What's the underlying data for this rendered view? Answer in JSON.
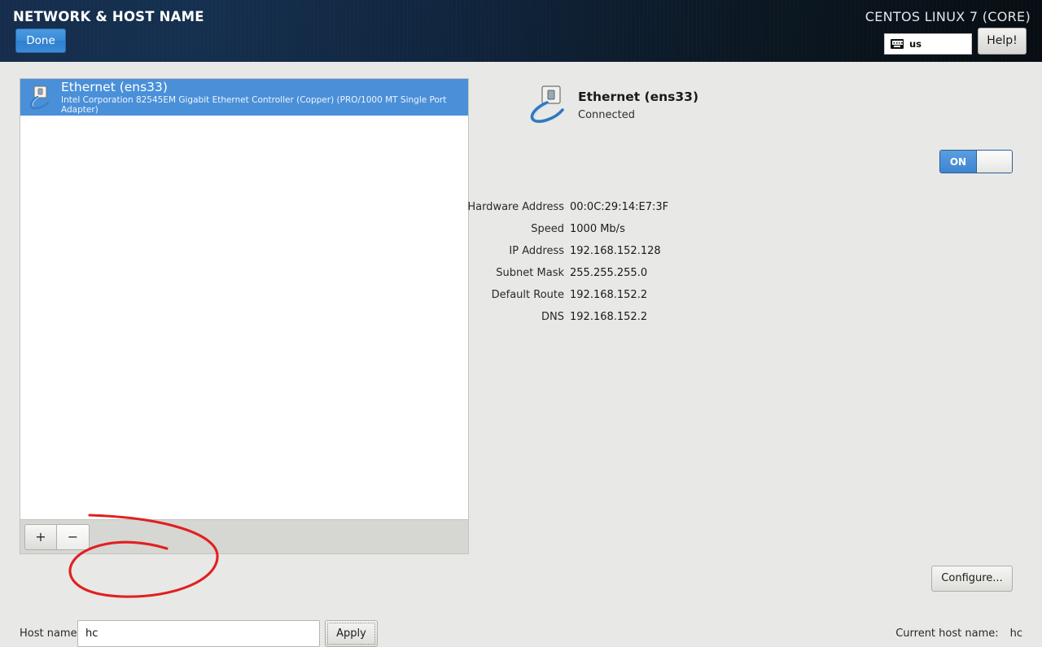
{
  "header": {
    "spine_title": "NETWORK & HOST NAME",
    "done_label": "Done",
    "distro_title": "CENTOS LINUX 7 (CORE)",
    "keyboard_layout": "us",
    "keyboard_icon": "keyboard-icon",
    "help_label": "Help!",
    "accent_color": "#4a90d9",
    "header_color": "#10243c"
  },
  "device_list": {
    "items": [
      {
        "name": "Ethernet (ens33)",
        "description": "Intel Corporation 82545EM Gigabit Ethernet Controller (Copper) (PRO/1000 MT Single Port Adapter)",
        "icon": "ethernet-icon",
        "selected": true
      }
    ],
    "toolbar": {
      "add_label": "+",
      "remove_label": "−"
    }
  },
  "detail": {
    "title": "Ethernet (ens33)",
    "state": "Connected",
    "icon": "ethernet-icon",
    "toggle": {
      "on_label": "ON",
      "state": "on"
    },
    "fields": [
      {
        "label": "Hardware Address",
        "value": "00:0C:29:14:E7:3F"
      },
      {
        "label": "Speed",
        "value": "1000 Mb/s"
      },
      {
        "label": "IP Address",
        "value": "192.168.152.128"
      },
      {
        "label": "Subnet Mask",
        "value": "255.255.255.0"
      },
      {
        "label": "Default Route",
        "value": "192.168.152.2"
      },
      {
        "label": "DNS",
        "value": "192.168.152.2"
      }
    ],
    "configure_label": "Configure..."
  },
  "footer": {
    "host_name_label": "Host name:",
    "host_name_value": "hc",
    "host_name_placeholder": "",
    "apply_label": "Apply",
    "current_host_name_label": "Current host name:",
    "current_host_name_value": "hc"
  },
  "annotation": {
    "color": "#e02020",
    "shape": "hand-drawn-ellipse-around-host-name-field"
  }
}
